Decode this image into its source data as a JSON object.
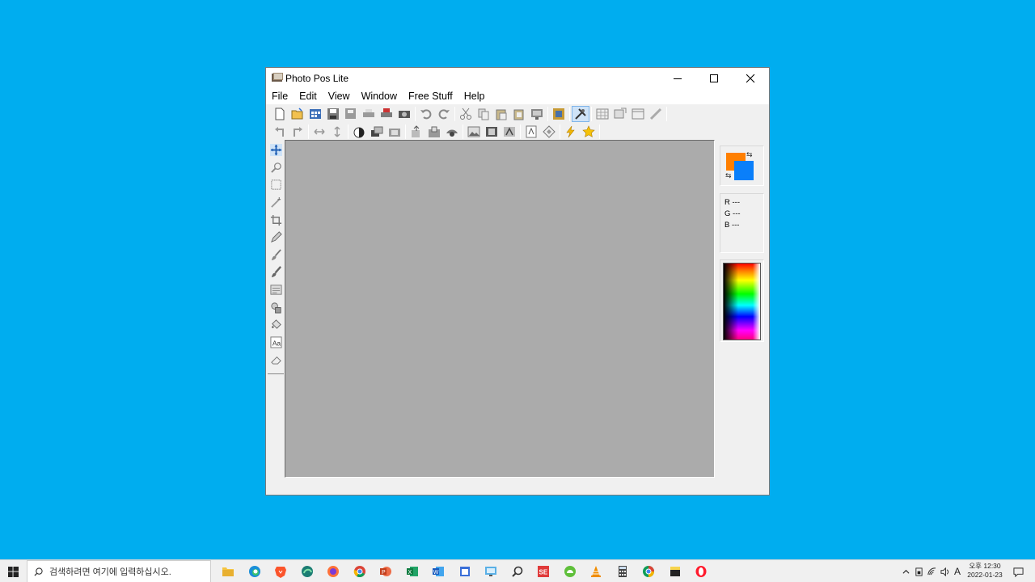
{
  "window": {
    "title": "Photo Pos Lite",
    "controls": [
      "minimize-icon",
      "maximize-icon",
      "close-icon"
    ]
  },
  "menubar": {
    "items": [
      "File",
      "Edit",
      "View",
      "Window",
      "Free Stuff",
      "Help"
    ]
  },
  "toolbar1": {
    "icons": [
      "new-file-icon",
      "open-folder-icon",
      "browse-icon",
      "save-icon",
      "save-as-icon",
      "print-icon",
      "print-setup-icon",
      "scanner-icon",
      "undo-icon",
      "redo-icon",
      "cut-icon",
      "copy-icon",
      "paste-icon",
      "paste-new-icon",
      "screen-capture-icon",
      "frames-icon",
      "tools-icon",
      "grid-icon",
      "transform-icon",
      "layer-icon",
      "ruler-icon"
    ]
  },
  "toolbar2": {
    "icons": [
      "rotate-left-icon",
      "rotate-right-icon",
      "flip-horizontal-icon",
      "flip-vertical-icon",
      "contrast-icon",
      "brightness-icon",
      "sharpen-icon",
      "resize-icon",
      "crop-canvas-icon",
      "effects-icon",
      "picture-icon",
      "picture-frame-icon",
      "mask-icon",
      "text-frame-icon",
      "shapes-icon",
      "lightning-icon",
      "star-icon"
    ]
  },
  "toolbox": {
    "icons": [
      "move-tool-icon",
      "zoom-tool-icon",
      "rectangle-select-icon",
      "magic-wand-icon",
      "crop-tool-icon",
      "pencil-tool-icon",
      "brush-tool-icon",
      "airbrush-tool-icon",
      "clone-tool-icon",
      "shapes-tool-icon",
      "fill-bucket-icon",
      "text-tool-icon",
      "eraser-tool-icon"
    ]
  },
  "colors": {
    "foreground": "#ff7f00",
    "background": "#0a7ffa"
  },
  "rgb": {
    "r": "R ---",
    "g": "G ---",
    "b": "B ---"
  },
  "taskbar": {
    "search_placeholder": "검색하려면 여기에 입력하십시오.",
    "apps": [
      "file-explorer-icon",
      "edge-icon",
      "brave-icon",
      "edge-dev-icon",
      "firefox-icon",
      "chrome-icon",
      "powerpoint-icon",
      "excel-icon",
      "word-icon",
      "calendar-app-icon",
      "remote-desktop-icon",
      "search-app-icon",
      "se-app-icon",
      "android-app-icon",
      "vlc-icon",
      "calculator-icon",
      "chrome-alt-icon",
      "sticky-notes-icon",
      "opera-icon"
    ],
    "ime": "A",
    "clock_time": "오후 12:30",
    "clock_date": "2022-01-23"
  }
}
